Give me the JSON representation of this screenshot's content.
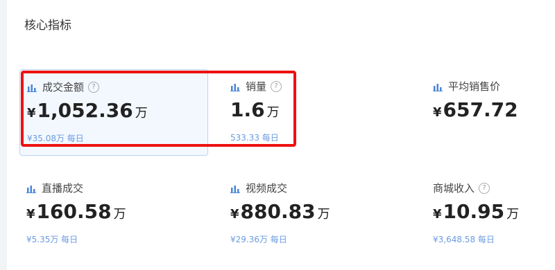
{
  "panel": {
    "title": "核心指标"
  },
  "metrics": [
    {
      "label": "成交金额",
      "has_help": true,
      "has_bar_icon": true,
      "currency": "¥",
      "value": "1,052.36",
      "unit": "万",
      "sub": "¥35.08万 每日",
      "selected": true
    },
    {
      "label": "销量",
      "has_help": true,
      "has_bar_icon": true,
      "currency": "",
      "value": "1.6",
      "unit": "万",
      "sub": "533.33 每日"
    },
    {
      "label": "平均销售价",
      "has_help": false,
      "has_bar_icon": true,
      "currency": "¥",
      "value": "657.72",
      "unit": "",
      "sub": ""
    },
    {
      "label": "直播成交",
      "has_help": false,
      "has_bar_icon": true,
      "currency": "¥",
      "value": "160.58",
      "unit": "万",
      "sub": "¥5.35万 每日"
    },
    {
      "label": "视频成交",
      "has_help": false,
      "has_bar_icon": true,
      "currency": "¥",
      "value": "880.83",
      "unit": "万",
      "sub": "¥29.36万 每日"
    },
    {
      "label": "商城收入",
      "has_help": true,
      "has_bar_icon": false,
      "currency": "¥",
      "value": "10.95",
      "unit": "万",
      "sub": "¥3,648.58 每日"
    }
  ],
  "help_glyph": "?",
  "colors": {
    "accent": "#6b9be0",
    "highlight_border": "#ee1111",
    "selected_bg": "#f3f8ff"
  }
}
